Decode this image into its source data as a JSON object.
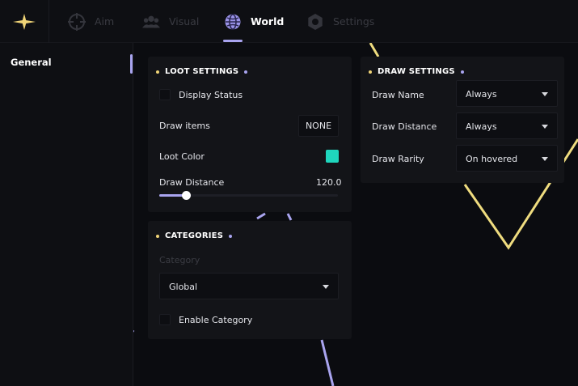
{
  "colors": {
    "accent": "#a9a4ef",
    "highlight": "#f0d477",
    "loot_color": "#1fd6bd"
  },
  "nav": {
    "logo_icon": "sparkle-star-icon",
    "tabs": [
      {
        "label": "Aim",
        "icon": "crosshair-icon",
        "active": false
      },
      {
        "label": "Visual",
        "icon": "users-icon",
        "active": false
      },
      {
        "label": "World",
        "icon": "globe-icon",
        "active": true
      },
      {
        "label": "Settings",
        "icon": "gear-icon",
        "active": false
      }
    ]
  },
  "sidebar": {
    "items": [
      {
        "label": "General",
        "active": true
      }
    ]
  },
  "loot_settings": {
    "title": "LOOT SETTINGS",
    "display_status_label": "Display Status",
    "display_status_checked": false,
    "draw_items_label": "Draw items",
    "draw_items_value": "NONE",
    "loot_color_label": "Loot Color",
    "draw_distance_label": "Draw Distance",
    "draw_distance_value": "120.0",
    "draw_distance_fraction": 0.15
  },
  "categories": {
    "title": "CATEGORIES",
    "category_label": "Category",
    "category_value": "Global",
    "enable_label": "Enable Category",
    "enable_checked": false
  },
  "draw_settings": {
    "title": "DRAW SETTINGS",
    "rows": [
      {
        "label": "Draw Name",
        "value": "Always"
      },
      {
        "label": "Draw Distance",
        "value": "Always"
      },
      {
        "label": "Draw Rarity",
        "value": "On hovered"
      }
    ]
  }
}
